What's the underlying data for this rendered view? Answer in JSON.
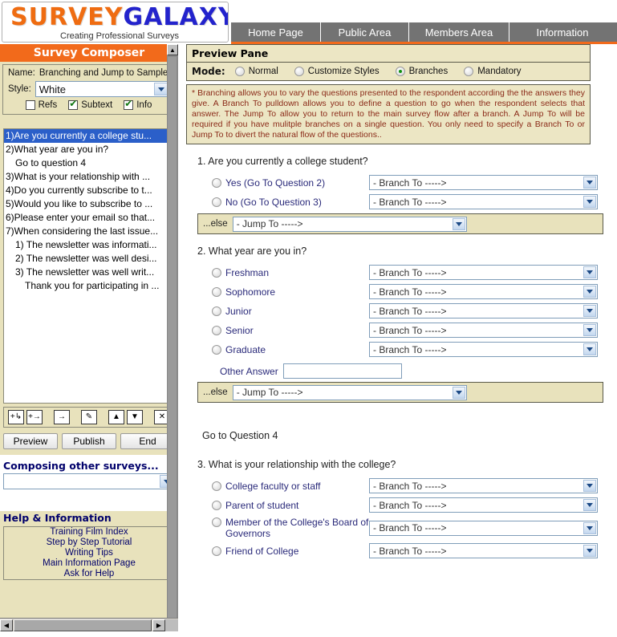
{
  "header": {
    "logo_part1": "SURVEY",
    "logo_part2": "GALAXY",
    "tagline": "Creating Professional Surveys",
    "nav": [
      {
        "label": "Home Page"
      },
      {
        "label": "Public Area"
      },
      {
        "label": "Members Area"
      },
      {
        "label": "Information"
      }
    ]
  },
  "sidebar": {
    "title": "Survey Composer",
    "name_label": "Name:",
    "name_value": "Branching and Jump to Sample Su...",
    "style_label": "Style:",
    "style_value": "White",
    "checkboxes": [
      {
        "label": "Refs",
        "checked": false
      },
      {
        "label": "Subtext",
        "checked": true
      },
      {
        "label": "Info",
        "checked": true
      }
    ],
    "questions": [
      {
        "text": "1)Are you currently a college stu...",
        "selected": true,
        "indent": 0
      },
      {
        "text": "2)What year are you in?",
        "selected": false,
        "indent": 0
      },
      {
        "text": "Go to question 4",
        "selected": false,
        "indent": 1
      },
      {
        "text": "3)What is your relationship with ...",
        "selected": false,
        "indent": 0
      },
      {
        "text": "4)Do you currently subscribe to t...",
        "selected": false,
        "indent": 0
      },
      {
        "text": "5)Would you like to subscribe to ...",
        "selected": false,
        "indent": 0
      },
      {
        "text": "6)Please enter your email so that...",
        "selected": false,
        "indent": 0
      },
      {
        "text": "7)When considering the last issue...",
        "selected": false,
        "indent": 0
      },
      {
        "text": "1) The newsletter was informati...",
        "selected": false,
        "indent": 1
      },
      {
        "text": "2) The newsletter was well desi...",
        "selected": false,
        "indent": 1
      },
      {
        "text": "3) The newsletter was well writ...",
        "selected": false,
        "indent": 1
      },
      {
        "text": "Thank you for participating in ...",
        "selected": false,
        "indent": 2
      }
    ],
    "tools": [
      {
        "name": "add-question-below-icon",
        "glyph": "+↳"
      },
      {
        "name": "add-question-after-icon",
        "glyph": "+→"
      },
      {
        "name": "indent-question-icon",
        "glyph": "→"
      },
      {
        "name": "edit-question-icon",
        "glyph": "✎"
      },
      {
        "name": "move-up-icon",
        "glyph": "▲"
      },
      {
        "name": "move-down-icon",
        "glyph": "▼"
      },
      {
        "name": "delete-question-icon",
        "glyph": "✕"
      }
    ],
    "buttons": [
      {
        "label": "Preview"
      },
      {
        "label": "Publish"
      },
      {
        "label": "End"
      }
    ],
    "other_surveys_heading": "Composing other surveys...",
    "other_surveys_value": "",
    "help_heading": "Help & Information",
    "help_links": [
      "Training Film Index",
      "Step by Step Tutorial",
      "Writing Tips",
      "Main Information Page",
      "Ask for Help"
    ]
  },
  "preview": {
    "title": "Preview Pane",
    "mode_label": "Mode:",
    "modes": [
      {
        "label": "Normal",
        "selected": false
      },
      {
        "label": "Customize Styles",
        "selected": false
      },
      {
        "label": "Branches",
        "selected": true
      },
      {
        "label": "Mandatory",
        "selected": false
      }
    ],
    "note": "* Branching allows you to vary the questions presented to the respondent according the the answers they give. A Branch To pulldown allows you to define a question to go when the respondent selects that answer. The Jump To allow you to return to the main survey flow after a branch. A Jump To will be required if you have mulitple branches on a single question. You only need to specify a Branch To or Jump To to divert the natural flow of the questions..",
    "branch_placeholder": "- Branch To ----->",
    "jump_placeholder": "- Jump To ----->",
    "else_label": "...else",
    "other_answer_label": "Other Answer",
    "other_answer_value": "",
    "goto_text": "Go to Question 4",
    "questions": [
      {
        "title": "1. Are you currently a college student?",
        "answers": [
          {
            "label": "Yes (Go To Question 2)",
            "branch": "- Branch To ----->"
          },
          {
            "label": "No (Go To Question 3)",
            "branch": "- Branch To ----->"
          }
        ],
        "has_else": true,
        "has_other": false
      },
      {
        "title": "2. What year are you in?",
        "answers": [
          {
            "label": "Freshman",
            "branch": "- Branch To ----->"
          },
          {
            "label": "Sophomore",
            "branch": "- Branch To ----->"
          },
          {
            "label": "Junior",
            "branch": "- Branch To ----->"
          },
          {
            "label": "Senior",
            "branch": "- Branch To ----->"
          },
          {
            "label": "Graduate",
            "branch": "- Branch To ----->"
          }
        ],
        "has_else": true,
        "has_other": true
      },
      {
        "title": "3. What is your relationship with the college?",
        "answers": [
          {
            "label": "College faculty or staff",
            "branch": "- Branch To ----->"
          },
          {
            "label": "Parent of student",
            "branch": "- Branch To ----->"
          },
          {
            "label": "Member of the College's Board of Governors",
            "branch": "- Branch To ----->"
          },
          {
            "label": "Friend of College",
            "branch": "- Branch To ----->"
          }
        ],
        "has_else": false,
        "has_other": false
      }
    ]
  },
  "colors": {
    "brand_orange": "#f26a1b",
    "brand_blue": "#2323cc",
    "panel_cream": "#e8e2bc",
    "nav_gray": "#737373",
    "selection_blue": "#2b5fc9",
    "note_red": "#8a2a18"
  }
}
